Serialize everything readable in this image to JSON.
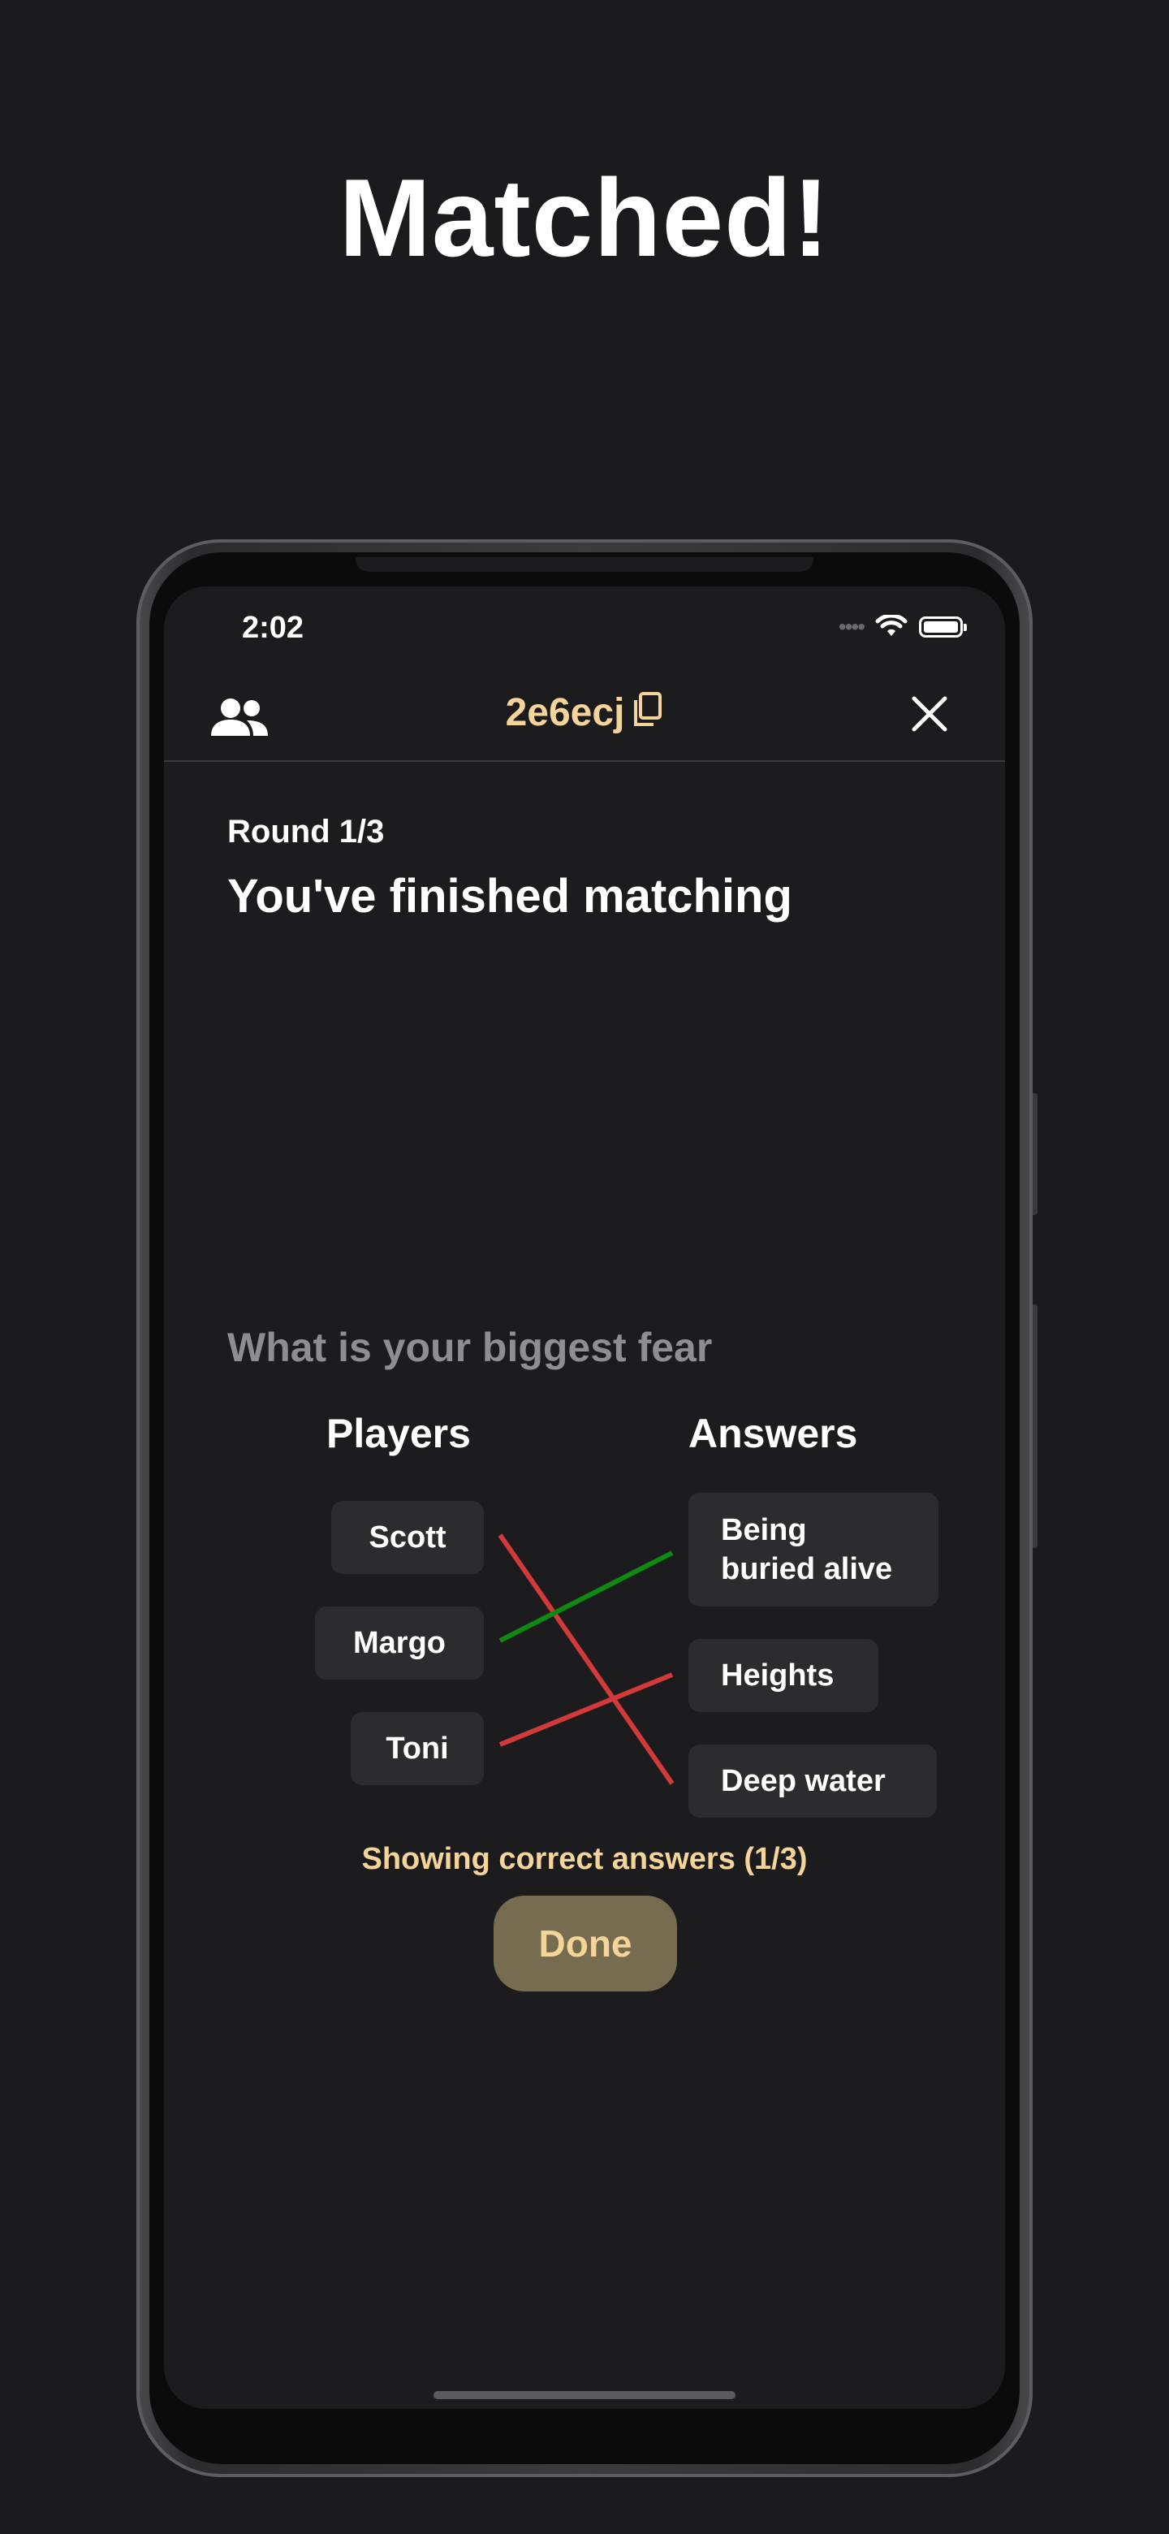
{
  "headline": "Matched!",
  "status_bar": {
    "time": "2:02",
    "signal": "••••"
  },
  "nav": {
    "room_code": "2e6ecj"
  },
  "round": {
    "label": "Round 1/3",
    "title": "You've finished matching"
  },
  "question": "What is your biggest fear",
  "columns": {
    "players": "Players",
    "answers": "Answers"
  },
  "players": [
    "Scott",
    "Margo",
    "Toni"
  ],
  "answers": [
    "Being\nburied alive",
    "Heights",
    "Deep water"
  ],
  "matches": [
    {
      "player": "Scott",
      "answer": "Deep water",
      "correct": false
    },
    {
      "player": "Margo",
      "answer": "Being buried alive",
      "correct": true
    },
    {
      "player": "Toni",
      "answer": "Heights",
      "correct": false
    }
  ],
  "colors": {
    "accent": "#f5d49a",
    "correct": "#0e8a12",
    "incorrect": "#d23a3a",
    "button_bg": "#766c50"
  },
  "status_message": "Showing correct answers (1/3)",
  "done_label": "Done"
}
